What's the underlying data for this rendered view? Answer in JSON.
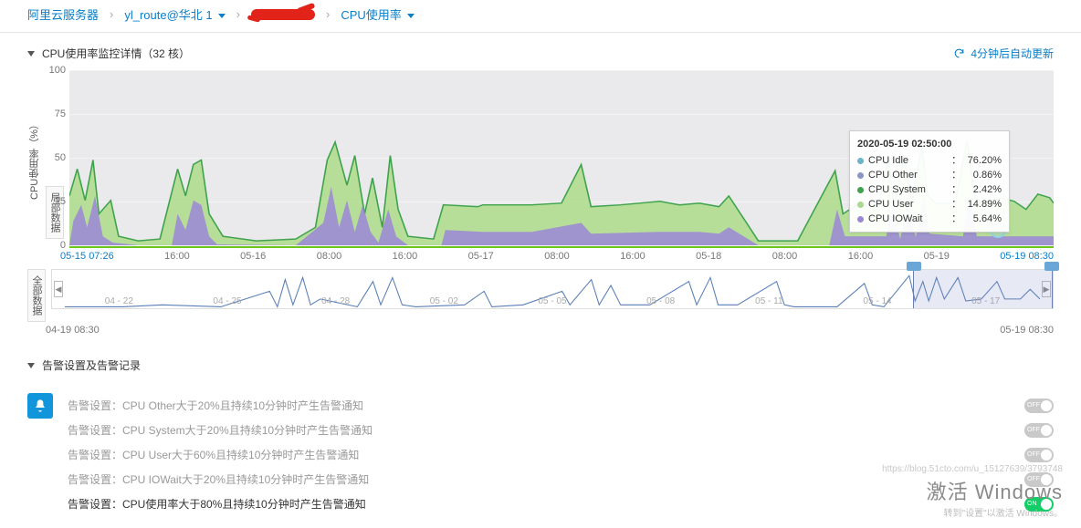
{
  "breadcrumb": {
    "a": "阿里云服务器",
    "b": "yl_route@华北 1",
    "c": "CPU使用率"
  },
  "panel": {
    "title": "CPU使用率监控详情（32 核）",
    "refresh": "4分钟后自动更新"
  },
  "chart_data": {
    "type": "area",
    "title": "CPU使用率监控详情（32 核）",
    "ylabel": "CPU使用率（%）",
    "ylim": [
      0,
      100
    ],
    "yticks": [
      0,
      25,
      50,
      75,
      100
    ],
    "x_start": "05-15 07:26",
    "x_end": "05-19 08:30",
    "x_ticks": [
      "05-15 07:26",
      "16:00",
      "05-16",
      "08:00",
      "16:00",
      "05-17",
      "08:00",
      "16:00",
      "05-18",
      "08:00",
      "16:00",
      "05-19",
      "05-19 08:30"
    ],
    "series": [
      {
        "name": "CPU Idle",
        "color": "#6bb4c9"
      },
      {
        "name": "CPU Other",
        "color": "#8c96c6"
      },
      {
        "name": "CPU System",
        "color": "#3fa34d"
      },
      {
        "name": "CPU User",
        "color": "#a8d98f"
      },
      {
        "name": "CPU IOWait",
        "color": "#9b87d6"
      }
    ],
    "tooltip": {
      "time": "2020-05-19 02:50:00",
      "rows": [
        {
          "name": "CPU Idle",
          "value": "76.20%",
          "color": "#6bb4c9"
        },
        {
          "name": "CPU Other",
          "value": "0.86%",
          "color": "#8c96c6"
        },
        {
          "name": "CPU System",
          "value": "2.42%",
          "color": "#3fa34d"
        },
        {
          "name": "CPU User",
          "value": "14.89%",
          "color": "#a8d98f"
        },
        {
          "name": "CPU IOWait",
          "value": "5.64%",
          "color": "#9b87d6"
        }
      ]
    },
    "overview": {
      "x_start": "04-19 08:30",
      "x_end": "05-19 08:30",
      "ticks": [
        "04 - 22",
        "04 - 25",
        "04 - 28",
        "05 - 02",
        "05 - 05",
        "05 - 08",
        "05 - 11",
        "05 - 14",
        "05 - 17"
      ],
      "selection_pct": [
        86,
        100
      ]
    },
    "side_label_main": "局部数据",
    "side_label_overview": "全部数据"
  },
  "alerts": {
    "header": "告警设置及告警记录",
    "prefix": "告警设置：",
    "items": [
      {
        "text": "CPU Other大于20%且持续10分钟时产生告警通知",
        "on": false
      },
      {
        "text": "CPU System大于20%且持续10分钟时产生告警通知",
        "on": false
      },
      {
        "text": "CPU User大于60%且持续10分钟时产生告警通知",
        "on": false
      },
      {
        "text": "CPU IOWait大于20%且持续10分钟时产生告警通知",
        "on": false
      },
      {
        "text": "CPU使用率大于80%且持续10分钟时产生告警通知",
        "on": true
      }
    ]
  },
  "watermark": {
    "url": "https://blog.51cto.com/u_15127639/3793748",
    "big": "激活 Windows",
    "small": "转到\"设置\"以激活 Windows。"
  }
}
